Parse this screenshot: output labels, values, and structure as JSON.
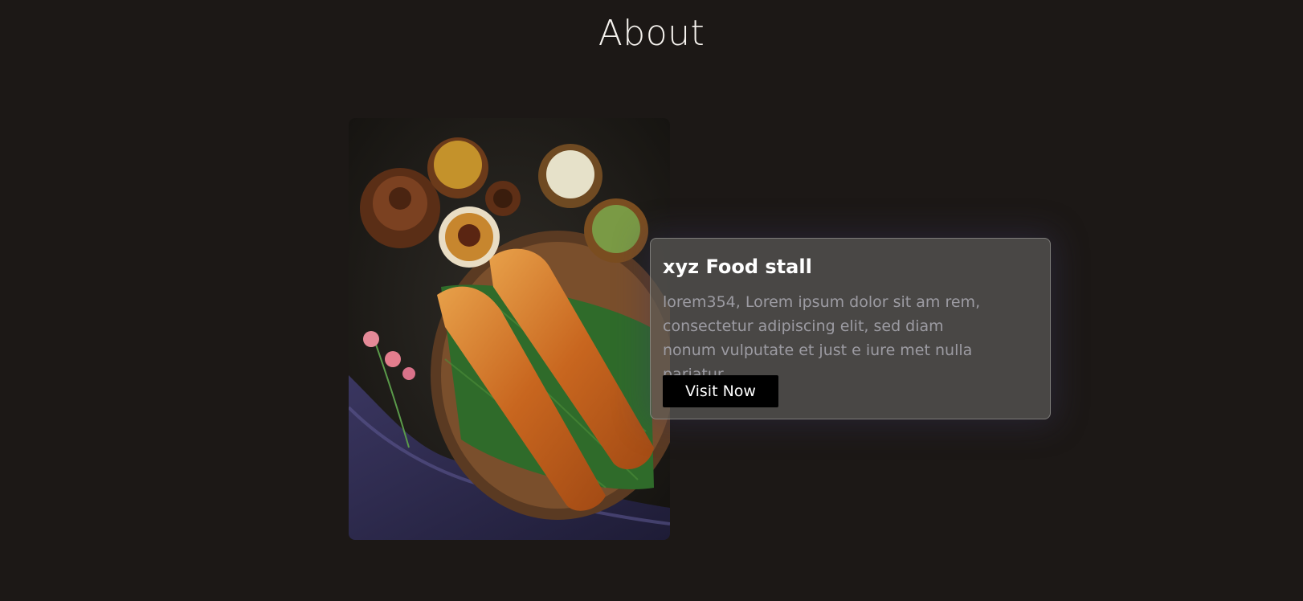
{
  "page": {
    "title": "About"
  },
  "about_card": {
    "title": "xyz Food stall",
    "description": "lorem354, Lorem ipsum dolor sit am rem, consectetur adipiscing elit, sed diam nonum vulputate et just e iure met nulla pariatur",
    "button_label": "Visit Now"
  },
  "colors": {
    "background": "#1c1816",
    "card_background": "#5c5a58",
    "button_background": "#000000",
    "title_text": "#f5f2ee",
    "body_text": "#9c9ba2"
  },
  "icons": {
    "photo": "food-photo"
  }
}
